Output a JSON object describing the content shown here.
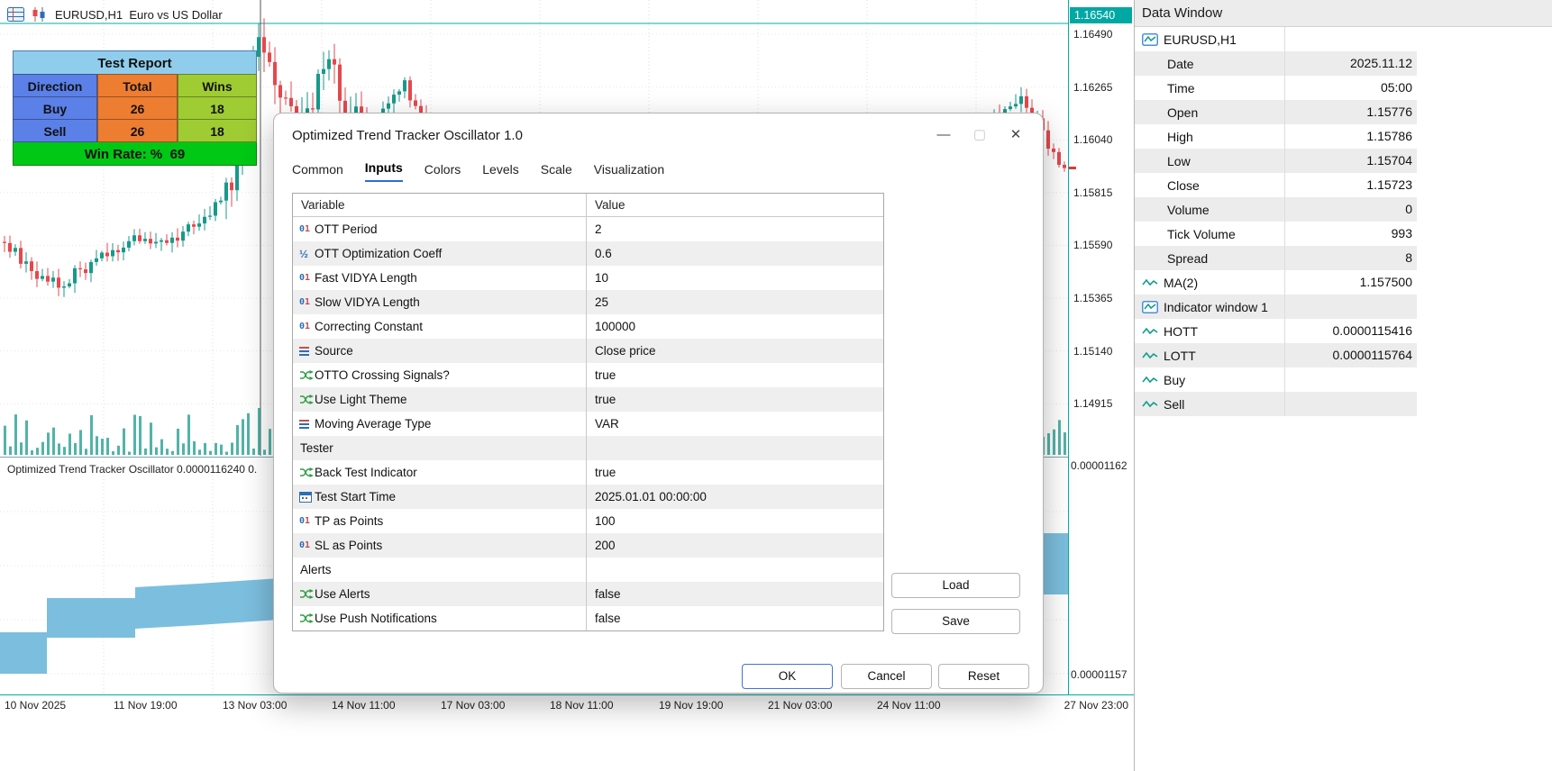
{
  "chart": {
    "symbol_title": "EURUSD,H1  Euro vs US Dollar",
    "indicator_label": "Optimized Trend Tracker Oscillator 0.0000116240 0.",
    "price_axis": {
      "current": "1.16540",
      "labels": [
        "1.16490",
        "1.16265",
        "1.16040",
        "1.15815",
        "1.15590",
        "1.15365",
        "1.15140",
        "1.14915"
      ],
      "sub_top": "0.00001162",
      "sub_bottom": "0.00001157"
    },
    "time_axis": [
      "10 Nov 2025",
      "11 Nov 19:00",
      "13 Nov 03:00",
      "14 Nov 11:00",
      "17 Nov 03:00",
      "18 Nov 11:00",
      "19 Nov 19:00",
      "21 Nov 03:00",
      "24 Nov 11:00",
      "27 Nov 23:00"
    ],
    "colors": {
      "up": "#18998b",
      "down": "#e5484d",
      "bid_line": "#00ada9",
      "band": "#7cbede",
      "volume": "#18998b",
      "grid": "#dcdcdc"
    }
  },
  "test_report": {
    "title": "Test Report",
    "headers": [
      "Direction",
      "Total",
      "Wins"
    ],
    "rows": [
      [
        "Buy",
        "26",
        "18"
      ],
      [
        "Sell",
        "26",
        "18"
      ]
    ],
    "win_rate": "Win Rate: %  69",
    "column_colors": [
      "#5b80e8",
      "#ed7d31",
      "#9fcb33"
    ],
    "title_bg": "#90cdec",
    "win_rate_bg": "#00c814"
  },
  "dialog": {
    "title": "Optimized Trend Tracker Oscillator 1.0",
    "controls": {
      "minimize": "—",
      "maximize": "▢",
      "close": "✕"
    },
    "tabs": [
      "Common",
      "Inputs",
      "Colors",
      "Levels",
      "Scale",
      "Visualization"
    ],
    "active_tab": "Inputs",
    "table": {
      "headers": [
        "Variable",
        "Value"
      ],
      "rows": [
        {
          "icon": "int",
          "name": "OTT Period",
          "value": "2"
        },
        {
          "icon": "frac",
          "name": "OTT Optimization Coeff",
          "value": "0.6"
        },
        {
          "icon": "int",
          "name": "Fast VIDYA Length",
          "value": "10"
        },
        {
          "icon": "int",
          "name": "Slow VIDYA Length",
          "value": "25"
        },
        {
          "icon": "int",
          "name": "Correcting Constant",
          "value": "100000"
        },
        {
          "icon": "enum",
          "name": "Source",
          "value": "Close price"
        },
        {
          "icon": "bool",
          "name": "OTTO Crossing Signals?",
          "value": "true"
        },
        {
          "icon": "bool",
          "name": "Use Light Theme",
          "value": "true"
        },
        {
          "icon": "enum",
          "name": "Moving Average Type",
          "value": "VAR"
        },
        {
          "icon": "none",
          "name": "Tester",
          "value": ""
        },
        {
          "icon": "bool",
          "name": "Back Test Indicator",
          "value": "true"
        },
        {
          "icon": "date",
          "name": "Test Start Time",
          "value": "2025.01.01 00:00:00"
        },
        {
          "icon": "int",
          "name": "TP as Points",
          "value": "100"
        },
        {
          "icon": "int",
          "name": "SL as Points",
          "value": "200"
        },
        {
          "icon": "none",
          "name": "Alerts",
          "value": ""
        },
        {
          "icon": "bool",
          "name": "Use Alerts",
          "value": "false"
        },
        {
          "icon": "bool",
          "name": "Use Push Notifications",
          "value": "false"
        }
      ]
    },
    "buttons": {
      "load": "Load",
      "save": "Save",
      "ok": "OK",
      "cancel": "Cancel",
      "reset": "Reset"
    }
  },
  "data_window": {
    "title": "Data Window",
    "symbol": "EURUSD,H1",
    "rows": [
      {
        "icon": "none",
        "label": "Date",
        "value": "2025.11.12"
      },
      {
        "icon": "none",
        "label": "Time",
        "value": "05:00"
      },
      {
        "icon": "none",
        "label": "Open",
        "value": "1.15776"
      },
      {
        "icon": "none",
        "label": "High",
        "value": "1.15786"
      },
      {
        "icon": "none",
        "label": "Low",
        "value": "1.15704"
      },
      {
        "icon": "none",
        "label": "Close",
        "value": "1.15723"
      },
      {
        "icon": "none",
        "label": "Volume",
        "value": "0"
      },
      {
        "icon": "none",
        "label": "Tick Volume",
        "value": "993"
      },
      {
        "icon": "none",
        "label": "Spread",
        "value": "8"
      },
      {
        "icon": "wave",
        "label": "MA(2)",
        "value": "1.157500"
      },
      {
        "icon": "boxwave",
        "label": "Indicator window 1",
        "value": ""
      },
      {
        "icon": "wave",
        "label": "HOTT",
        "value": "0.0000115416"
      },
      {
        "icon": "wave",
        "label": "LOTT",
        "value": "0.0000115764"
      },
      {
        "icon": "wave",
        "label": "Buy",
        "value": ""
      },
      {
        "icon": "wave",
        "label": "Sell",
        "value": ""
      }
    ]
  }
}
